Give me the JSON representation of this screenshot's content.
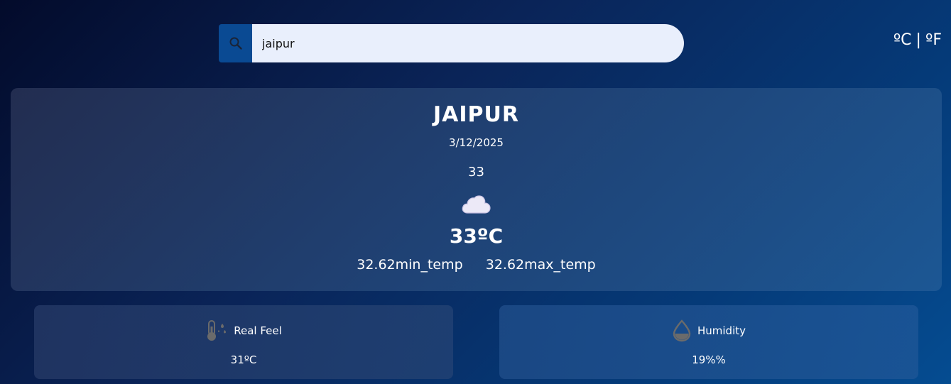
{
  "search": {
    "value": "jaipur",
    "icon": "search-icon"
  },
  "units": {
    "celsius": "ºC",
    "separator": "|",
    "fahrenheit": "ºF"
  },
  "weather": {
    "city": "JAIPUR",
    "date": "3/12/2025",
    "temp_raw": "33",
    "condition_icon": "cloud-icon",
    "temp_display": "33ºC",
    "min_temp": "32.62min_temp",
    "max_temp": "32.62max_temp"
  },
  "details": {
    "real_feel": {
      "icon": "thermometer-icon",
      "label": "Real Feel",
      "value": "31ºC"
    },
    "humidity": {
      "icon": "water-drop-icon",
      "label": "Humidity",
      "value": "19%%"
    }
  },
  "colors": {
    "accent": "#0a4a93",
    "input_bg": "#e9effc",
    "icon_gray": "#6b6b6b"
  }
}
